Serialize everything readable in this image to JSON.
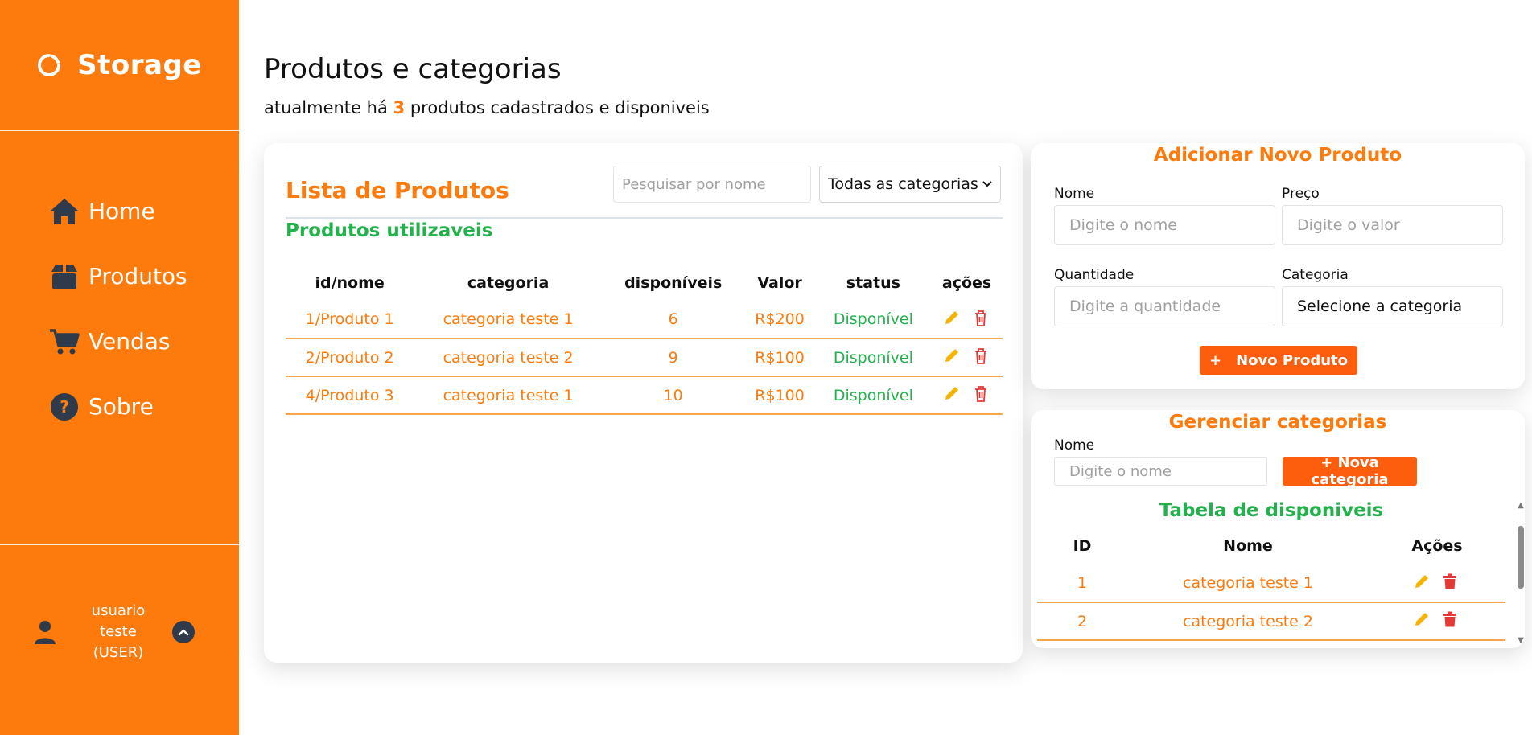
{
  "brand": {
    "name": "Storage"
  },
  "nav": [
    {
      "label": "Home",
      "icon": "home-icon"
    },
    {
      "label": "Produtos",
      "icon": "box-icon"
    },
    {
      "label": "Vendas",
      "icon": "cart-icon"
    },
    {
      "label": "Sobre",
      "icon": "question-icon"
    }
  ],
  "user": {
    "name": "usuario teste",
    "role": "(USER)"
  },
  "header": {
    "title": "Produtos e categorias",
    "subtitle_prefix": "atualmente há",
    "count": "3",
    "subtitle_suffix": "produtos cadastrados e disponiveis"
  },
  "products": {
    "title": "Lista de Produtos",
    "search_placeholder": "Pesquisar por nome",
    "category_filter": "Todas as categorias",
    "section_title": "Produtos utilizaveis",
    "columns": [
      "id/nome",
      "categoria",
      "disponíveis",
      "Valor",
      "status",
      "ações"
    ],
    "rows": [
      {
        "idname": "1/Produto 1",
        "category": "categoria teste 1",
        "available": "6",
        "value": "R$200",
        "status": "Disponível"
      },
      {
        "idname": "2/Produto 2",
        "category": "categoria teste 2",
        "available": "9",
        "value": "R$100",
        "status": "Disponível"
      },
      {
        "idname": "4/Produto 3",
        "category": "categoria teste 1",
        "available": "10",
        "value": "R$100",
        "status": "Disponível"
      }
    ]
  },
  "add_product": {
    "title": "Adicionar Novo Produto",
    "name_label": "Nome",
    "name_placeholder": "Digite o nome",
    "price_label": "Preço",
    "price_placeholder": "Digite o valor",
    "qty_label": "Quantidade",
    "qty_placeholder": "Digite a quantidade",
    "category_label": "Categoria",
    "category_value": "Selecione a categoria",
    "button_plus": "+",
    "button_label": "Novo Produto"
  },
  "categories": {
    "title": "Gerenciar categorias",
    "name_label": "Nome",
    "name_placeholder": "Digite o nome",
    "button_label": "+ Nova categoria",
    "table_title": "Tabela de disponiveis",
    "columns": [
      "ID",
      "Nome",
      "Ações"
    ],
    "rows": [
      {
        "id": "1",
        "name": "categoria teste 1"
      },
      {
        "id": "2",
        "name": "categoria teste 2"
      }
    ]
  },
  "colors": {
    "accent": "#fd7b0d",
    "button": "#fd5e0d",
    "success": "#22b24c",
    "edit": "#f5b400",
    "delete": "#e53935"
  }
}
